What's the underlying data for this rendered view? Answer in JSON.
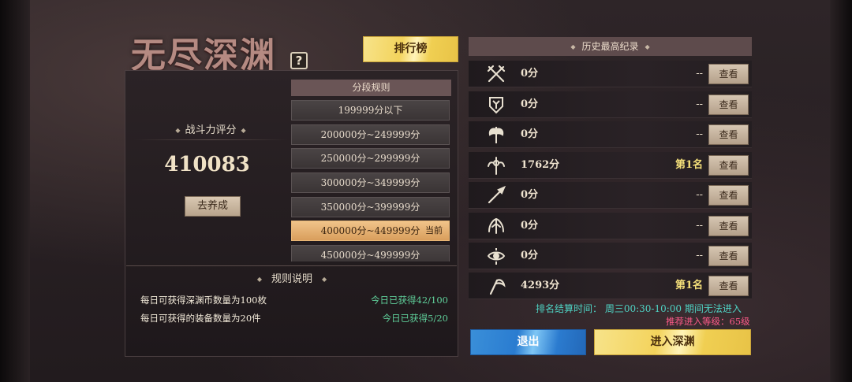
{
  "title": "无尽深渊",
  "help_icon_glyph": "?",
  "leaderboard_button": "排行榜",
  "power": {
    "label": "战斗力评分",
    "value": "410083",
    "cultivate_button": "去养成"
  },
  "segments": {
    "header": "分段规则",
    "current_tag": "当前",
    "items": [
      {
        "label": "199999分以下",
        "current": false
      },
      {
        "label": "200000分~249999分",
        "current": false
      },
      {
        "label": "250000分~299999分",
        "current": false
      },
      {
        "label": "300000分~349999分",
        "current": false
      },
      {
        "label": "350000分~399999分",
        "current": false
      },
      {
        "label": "400000分~449999分",
        "current": true
      },
      {
        "label": "450000分~499999分",
        "current": false
      }
    ]
  },
  "rules": {
    "title": "规则说明",
    "items": [
      {
        "text": "每日可获得深渊币数量为100枚",
        "status": "今日已获得42/100"
      },
      {
        "text": "每日可获得的装备数量为20件",
        "status": "今日已获得5/20"
      }
    ]
  },
  "history": {
    "header": "历史最高纪录",
    "view_label": "查看",
    "rows": [
      {
        "icon": "crossed-swords-icon",
        "score": "0分",
        "rank": "--"
      },
      {
        "icon": "shield-emblem-icon",
        "score": "0分",
        "rank": "--"
      },
      {
        "icon": "axe-icon",
        "score": "0分",
        "rank": "--"
      },
      {
        "icon": "winged-staff-icon",
        "score": "1762分",
        "rank": "第1名"
      },
      {
        "icon": "spear-icon",
        "score": "0分",
        "rank": "--"
      },
      {
        "icon": "bow-icon",
        "score": "0分",
        "rank": "--"
      },
      {
        "icon": "eye-emblem-icon",
        "score": "0分",
        "rank": "--"
      },
      {
        "icon": "scythe-icon",
        "score": "4293分",
        "rank": "第1名"
      }
    ]
  },
  "settle_time": "排名结算时间： 周三00:30-10:00 期间无法进入",
  "recommend_level": "推荐进入等级：65级",
  "exit_button": "退出",
  "enter_button": "进入深渊",
  "colors": {
    "accent_gold": "#f3d35c",
    "exit_blue": "#2a7cd0",
    "status_green": "#5fcf9a",
    "settle_cyan": "#4fd3c4",
    "recommend_pink": "#ff5b8a",
    "rank_gold": "#f5e07a",
    "title": "#b58a82"
  }
}
